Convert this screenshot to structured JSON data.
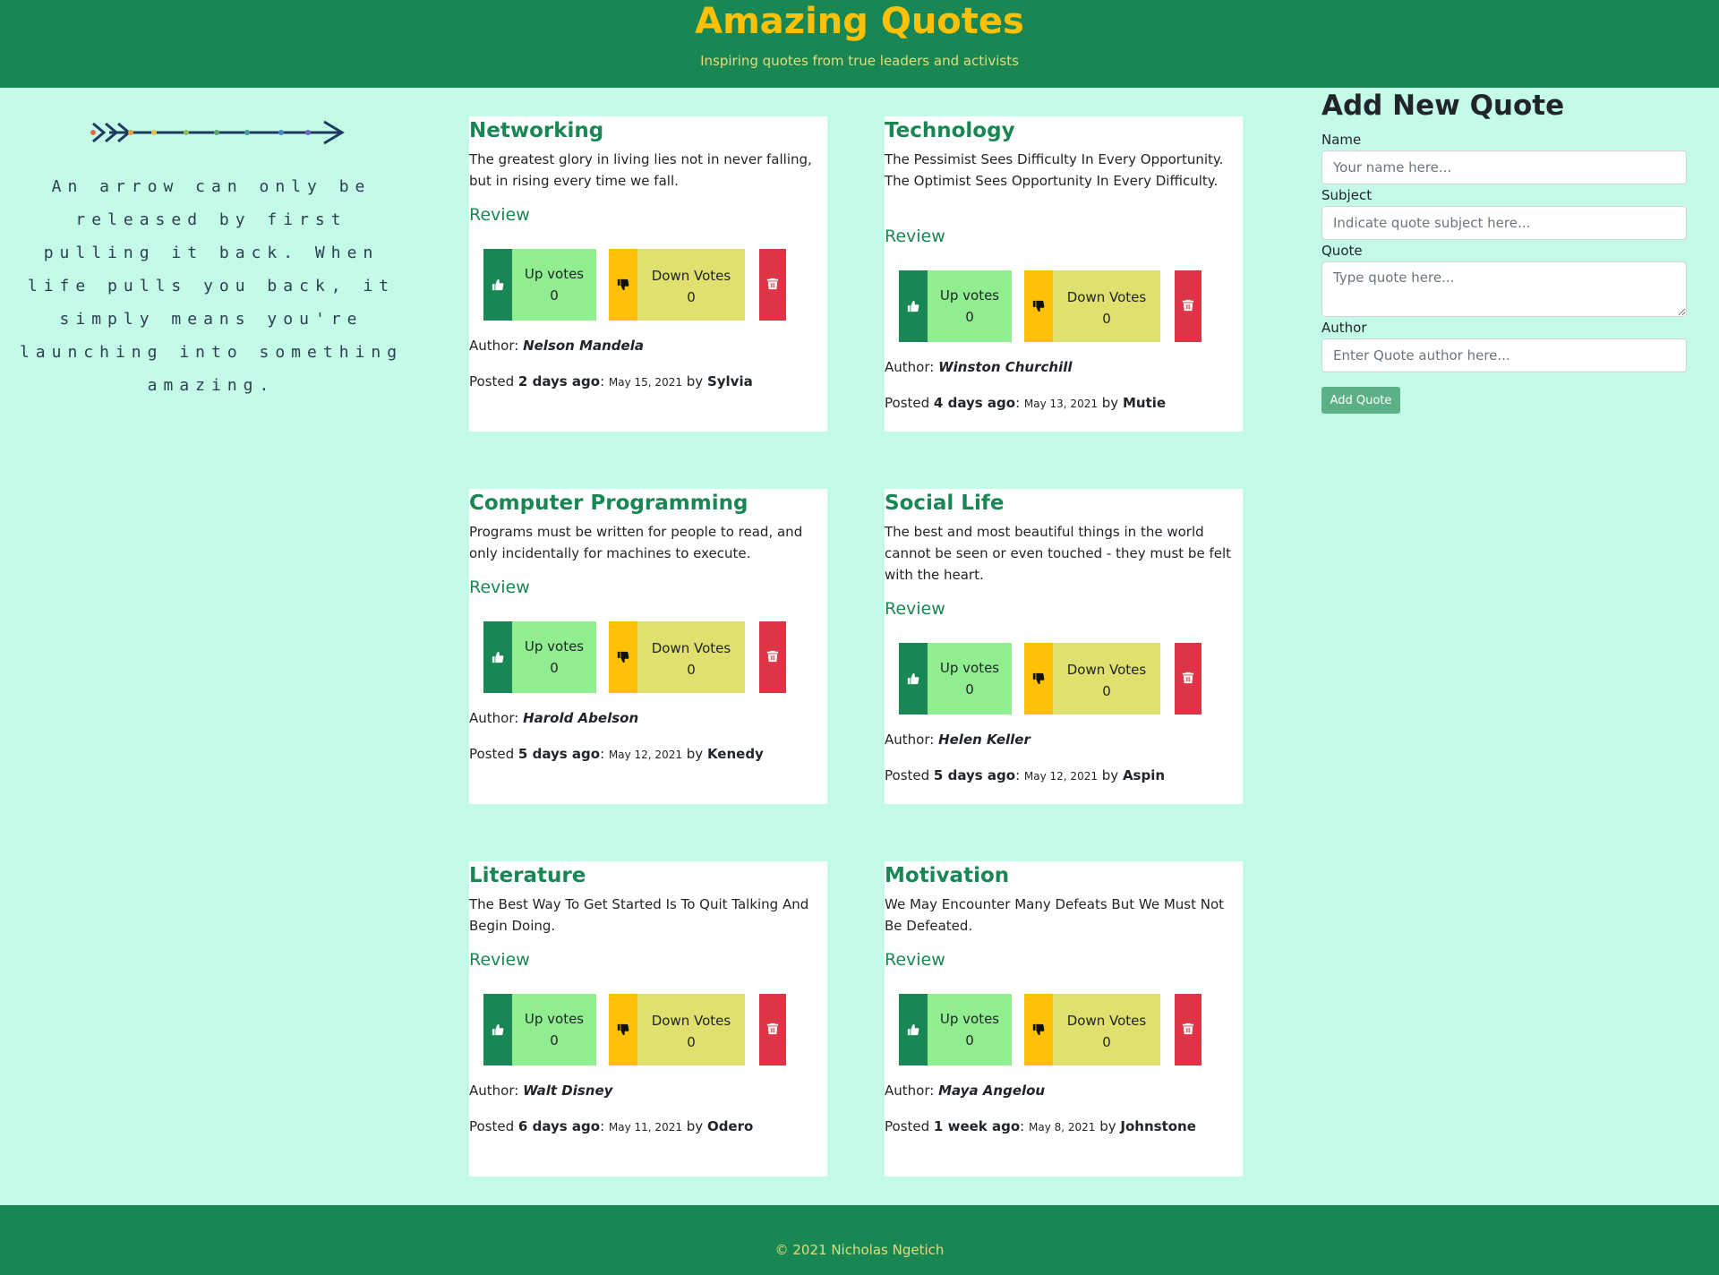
{
  "header": {
    "title": "Amazing Quotes",
    "subtitle": "Inspiring quotes from true leaders and activists"
  },
  "side_image": {
    "text": "An arrow can only be released by first pulling it back. When life pulls you back, it simply means you're launching into something amazing."
  },
  "common": {
    "review_label": "Review",
    "upvotes_label": "Up votes",
    "downvotes_label": "Down Votes",
    "author_prefix": "Author:",
    "posted_prefix": "Posted",
    "by_label": "by"
  },
  "quotes": [
    {
      "subject": "Networking",
      "text": "The greatest glory in living lies not in never falling, but in rising every time we fall.",
      "upvotes": "0",
      "downvotes": "0",
      "author": "Nelson Mandela",
      "ago": "2 days ago",
      "date": "May 15, 2021",
      "poster": "Sylvia"
    },
    {
      "subject": "Technology",
      "text": "The Pessimist Sees Difficulty In Every Opportunity. The Optimist Sees Opportunity In Every Difficulty.",
      "upvotes": "0",
      "downvotes": "0",
      "author": "Winston Churchill",
      "ago": "4 days ago",
      "date": "May 13, 2021",
      "poster": "Mutie"
    },
    {
      "subject": "Computer Programming",
      "text": "Programs must be written for people to read, and only incidentally for machines to execute.",
      "upvotes": "0",
      "downvotes": "0",
      "author": "Harold Abelson",
      "ago": "5 days ago",
      "date": "May 12, 2021",
      "poster": "Kenedy"
    },
    {
      "subject": "Social Life",
      "text": "The best and most beautiful things in the world cannot be seen or even touched - they must be felt with the heart.",
      "upvotes": "0",
      "downvotes": "0",
      "author": "Helen Keller",
      "ago": "5 days ago",
      "date": "May 12, 2021",
      "poster": "Aspin"
    },
    {
      "subject": "Literature",
      "text": "The Best Way To Get Started Is To Quit Talking And Begin Doing.",
      "upvotes": "0",
      "downvotes": "0",
      "author": "Walt Disney",
      "ago": "6 days ago",
      "date": "May 11, 2021",
      "poster": "Odero"
    },
    {
      "subject": "Motivation",
      "text": "We May Encounter Many Defeats But We Must Not Be Defeated.",
      "upvotes": "0",
      "downvotes": "0",
      "author": "Maya Angelou",
      "ago": "1 week ago",
      "date": "May 8, 2021",
      "poster": "Johnstone"
    }
  ],
  "form": {
    "title": "Add New Quote",
    "name_label": "Name",
    "name_placeholder": "Your name here...",
    "subject_label": "Subject",
    "subject_placeholder": "Indicate quote subject here...",
    "quote_label": "Quote",
    "quote_placeholder": "Type quote here...",
    "author_label": "Author",
    "author_placeholder": "Enter Quote author here...",
    "submit_label": "Add Quote"
  },
  "footer": {
    "text": "© 2021 Nicholas Ngetich"
  },
  "colors": {
    "primary_green": "#198754",
    "accent_yellow": "#ffc107",
    "page_background": "#c3fae8",
    "upvote_fill": "#90ee90",
    "downvote_fill": "#e0e06e",
    "delete_red": "#dc3545"
  },
  "icons": {
    "upvote": "thumbs-up-icon",
    "downvote": "thumbs-down-icon",
    "delete": "trash-icon",
    "decor": "arrow-icon"
  }
}
